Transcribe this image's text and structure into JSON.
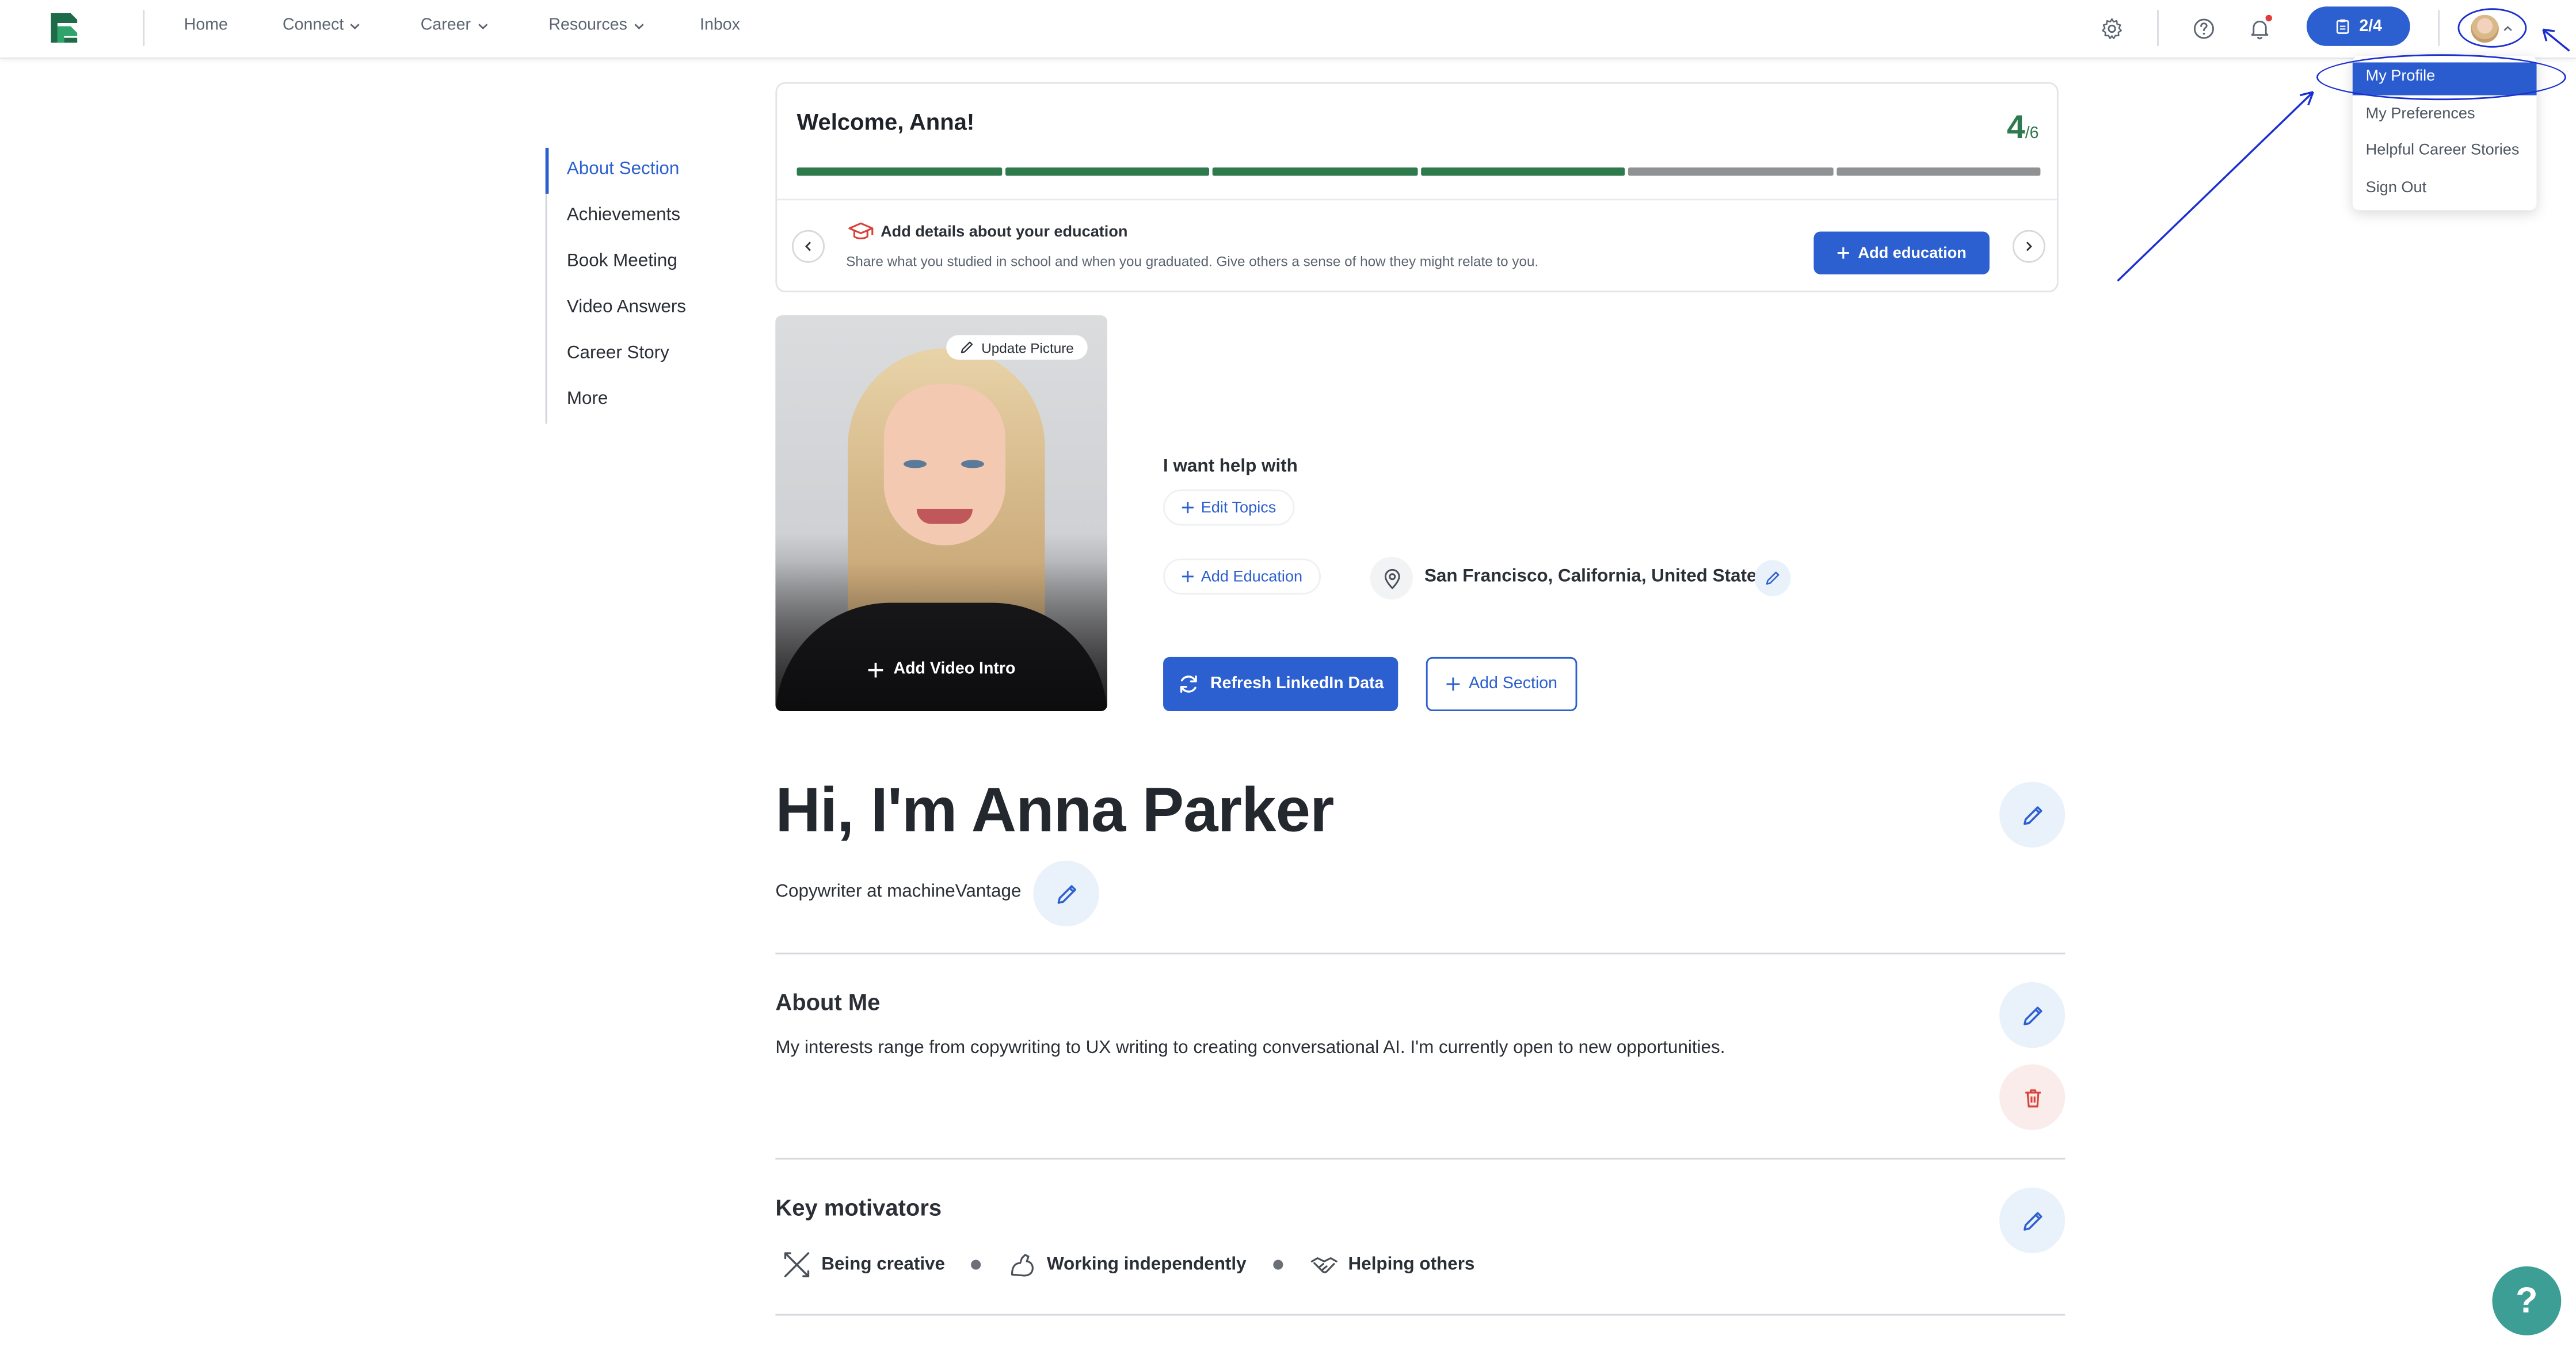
{
  "nav": {
    "items": [
      {
        "label": "Home",
        "has_dropdown": false
      },
      {
        "label": "Connect",
        "has_dropdown": true
      },
      {
        "label": "Career",
        "has_dropdown": true
      },
      {
        "label": "Resources",
        "has_dropdown": true
      },
      {
        "label": "Inbox",
        "has_dropdown": false
      }
    ],
    "progress_badge": "2/4"
  },
  "profile_menu": {
    "items": [
      "My Profile",
      "My Preferences",
      "Helpful Career Stories",
      "Sign Out"
    ],
    "active": "My Profile"
  },
  "section_nav": {
    "items": [
      "About Section",
      "Achievements",
      "Book Meeting",
      "Video Answers",
      "Career Story",
      "More"
    ],
    "active": "About Section"
  },
  "welcome": {
    "title": "Welcome, Anna!",
    "progress_done": "4",
    "progress_total": "/6",
    "progress_fraction": 0.667,
    "step_title": "Add details about your education",
    "step_desc": "Share what you studied in school and when you graduated. Give others a sense of how they might relate to you.",
    "step_button": "Add education"
  },
  "photo": {
    "update_label": "Update Picture",
    "video_label": "Add Video Intro"
  },
  "profile": {
    "help_label": "I want help with",
    "edit_topics": "Edit Topics",
    "add_education": "Add Education",
    "location": "San Francisco, California, United States",
    "refresh_button": "Refresh LinkedIn Data",
    "add_section_button": "Add Section",
    "name": "Hi, I'm Anna Parker",
    "headline": "Copywriter at machineVantage"
  },
  "about": {
    "title": "About Me",
    "text": "My interests range from copywriting to UX writing to creating conversational AI. I'm currently open to new opportunities."
  },
  "motivators": {
    "title": "Key motivators",
    "items": [
      "Being creative",
      "Working independently",
      "Helping others"
    ]
  },
  "help_fab": "?",
  "colors": {
    "accent": "#2c5fcf",
    "progress_done": "#2f7a4d",
    "progress_todo": "#8f9193",
    "annotation": "#1b2fd1",
    "help_fab": "#3d9e96"
  }
}
